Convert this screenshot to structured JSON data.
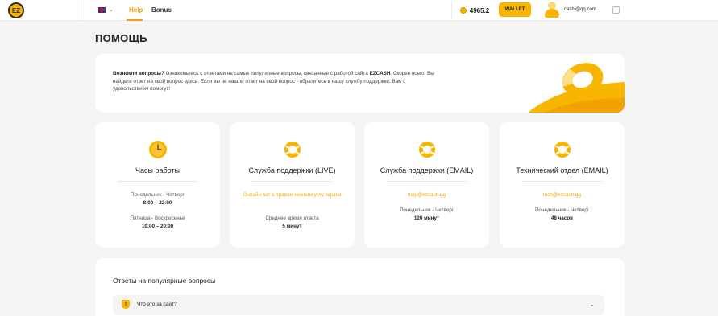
{
  "header": {
    "logo_text": "EZ",
    "nav": {
      "help": "Help",
      "bonus": "Bonus"
    },
    "balance": "4965.2",
    "wallet_label": "WALLET",
    "user_email": "cashi@qq.com"
  },
  "page_title": "ПОМОЩЬ",
  "intro": {
    "lead": "Возникли вопросы?",
    "text_1": " Ознакомьтесь с ответами на самые популярные вопросы, связанные с работой сайта ",
    "brand": "EZCASH",
    "text_2": ". Скорее всего, Вы найдете ответ на свой вопрос здесь. Если вы не нашли ответ на свой вопрос - обратитесь в нашу службу поддержки. Вам с удовольствием помогут!"
  },
  "cards": [
    {
      "title": "Часы работы",
      "row1_label": "Понедельник - Четверг",
      "row1_value": "8:00 – 22:00",
      "row2_label": "Пятница - Воскресенье",
      "row2_value": "10:00 – 20:00"
    },
    {
      "title": "Служба поддержки (LIVE)",
      "note": "Онлайн чат в правом нижнем углу экрана",
      "label": "Среднее время ответа",
      "value": "5 минут"
    },
    {
      "title": "Служба поддержки (EMAIL)",
      "email": "help@ezcash.gg",
      "label": "Понедельник - Четверг",
      "value": "120 минут"
    },
    {
      "title": "Технический отдел (EMAIL)",
      "email": "tech@ezcash.gg",
      "label": "Понедельник - Четверг",
      "value": "48 часов"
    }
  ],
  "faq": {
    "title": "Ответы на популярные вопросы",
    "items": [
      {
        "question": "Что это за сайт?"
      }
    ]
  },
  "colors": {
    "accent": "#f7b500",
    "accent_text": "#f2a200",
    "background": "#f6f4f2"
  }
}
